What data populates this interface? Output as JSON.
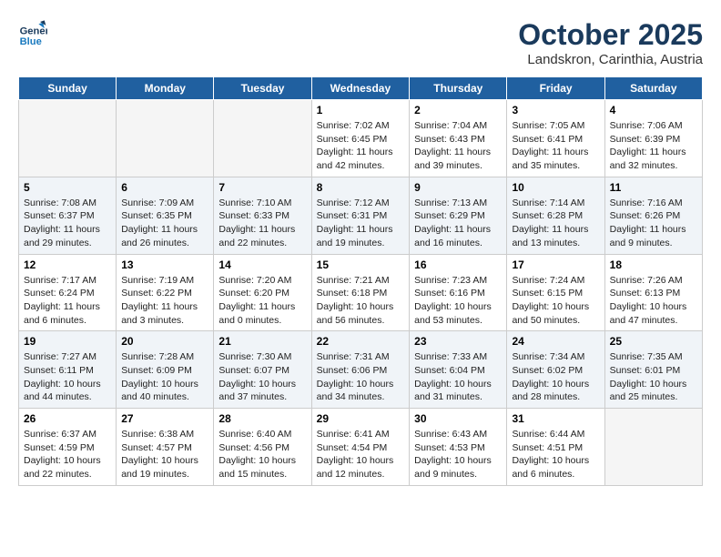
{
  "header": {
    "logo_line1": "General",
    "logo_line2": "Blue",
    "month": "October 2025",
    "location": "Landskron, Carinthia, Austria"
  },
  "weekdays": [
    "Sunday",
    "Monday",
    "Tuesday",
    "Wednesday",
    "Thursday",
    "Friday",
    "Saturday"
  ],
  "weeks": [
    [
      {
        "day": "",
        "info": ""
      },
      {
        "day": "",
        "info": ""
      },
      {
        "day": "",
        "info": ""
      },
      {
        "day": "1",
        "info": "Sunrise: 7:02 AM\nSunset: 6:45 PM\nDaylight: 11 hours\nand 42 minutes."
      },
      {
        "day": "2",
        "info": "Sunrise: 7:04 AM\nSunset: 6:43 PM\nDaylight: 11 hours\nand 39 minutes."
      },
      {
        "day": "3",
        "info": "Sunrise: 7:05 AM\nSunset: 6:41 PM\nDaylight: 11 hours\nand 35 minutes."
      },
      {
        "day": "4",
        "info": "Sunrise: 7:06 AM\nSunset: 6:39 PM\nDaylight: 11 hours\nand 32 minutes."
      }
    ],
    [
      {
        "day": "5",
        "info": "Sunrise: 7:08 AM\nSunset: 6:37 PM\nDaylight: 11 hours\nand 29 minutes."
      },
      {
        "day": "6",
        "info": "Sunrise: 7:09 AM\nSunset: 6:35 PM\nDaylight: 11 hours\nand 26 minutes."
      },
      {
        "day": "7",
        "info": "Sunrise: 7:10 AM\nSunset: 6:33 PM\nDaylight: 11 hours\nand 22 minutes."
      },
      {
        "day": "8",
        "info": "Sunrise: 7:12 AM\nSunset: 6:31 PM\nDaylight: 11 hours\nand 19 minutes."
      },
      {
        "day": "9",
        "info": "Sunrise: 7:13 AM\nSunset: 6:29 PM\nDaylight: 11 hours\nand 16 minutes."
      },
      {
        "day": "10",
        "info": "Sunrise: 7:14 AM\nSunset: 6:28 PM\nDaylight: 11 hours\nand 13 minutes."
      },
      {
        "day": "11",
        "info": "Sunrise: 7:16 AM\nSunset: 6:26 PM\nDaylight: 11 hours\nand 9 minutes."
      }
    ],
    [
      {
        "day": "12",
        "info": "Sunrise: 7:17 AM\nSunset: 6:24 PM\nDaylight: 11 hours\nand 6 minutes."
      },
      {
        "day": "13",
        "info": "Sunrise: 7:19 AM\nSunset: 6:22 PM\nDaylight: 11 hours\nand 3 minutes."
      },
      {
        "day": "14",
        "info": "Sunrise: 7:20 AM\nSunset: 6:20 PM\nDaylight: 11 hours\nand 0 minutes."
      },
      {
        "day": "15",
        "info": "Sunrise: 7:21 AM\nSunset: 6:18 PM\nDaylight: 10 hours\nand 56 minutes."
      },
      {
        "day": "16",
        "info": "Sunrise: 7:23 AM\nSunset: 6:16 PM\nDaylight: 10 hours\nand 53 minutes."
      },
      {
        "day": "17",
        "info": "Sunrise: 7:24 AM\nSunset: 6:15 PM\nDaylight: 10 hours\nand 50 minutes."
      },
      {
        "day": "18",
        "info": "Sunrise: 7:26 AM\nSunset: 6:13 PM\nDaylight: 10 hours\nand 47 minutes."
      }
    ],
    [
      {
        "day": "19",
        "info": "Sunrise: 7:27 AM\nSunset: 6:11 PM\nDaylight: 10 hours\nand 44 minutes."
      },
      {
        "day": "20",
        "info": "Sunrise: 7:28 AM\nSunset: 6:09 PM\nDaylight: 10 hours\nand 40 minutes."
      },
      {
        "day": "21",
        "info": "Sunrise: 7:30 AM\nSunset: 6:07 PM\nDaylight: 10 hours\nand 37 minutes."
      },
      {
        "day": "22",
        "info": "Sunrise: 7:31 AM\nSunset: 6:06 PM\nDaylight: 10 hours\nand 34 minutes."
      },
      {
        "day": "23",
        "info": "Sunrise: 7:33 AM\nSunset: 6:04 PM\nDaylight: 10 hours\nand 31 minutes."
      },
      {
        "day": "24",
        "info": "Sunrise: 7:34 AM\nSunset: 6:02 PM\nDaylight: 10 hours\nand 28 minutes."
      },
      {
        "day": "25",
        "info": "Sunrise: 7:35 AM\nSunset: 6:01 PM\nDaylight: 10 hours\nand 25 minutes."
      }
    ],
    [
      {
        "day": "26",
        "info": "Sunrise: 6:37 AM\nSunset: 4:59 PM\nDaylight: 10 hours\nand 22 minutes."
      },
      {
        "day": "27",
        "info": "Sunrise: 6:38 AM\nSunset: 4:57 PM\nDaylight: 10 hours\nand 19 minutes."
      },
      {
        "day": "28",
        "info": "Sunrise: 6:40 AM\nSunset: 4:56 PM\nDaylight: 10 hours\nand 15 minutes."
      },
      {
        "day": "29",
        "info": "Sunrise: 6:41 AM\nSunset: 4:54 PM\nDaylight: 10 hours\nand 12 minutes."
      },
      {
        "day": "30",
        "info": "Sunrise: 6:43 AM\nSunset: 4:53 PM\nDaylight: 10 hours\nand 9 minutes."
      },
      {
        "day": "31",
        "info": "Sunrise: 6:44 AM\nSunset: 4:51 PM\nDaylight: 10 hours\nand 6 minutes."
      },
      {
        "day": "",
        "info": ""
      }
    ]
  ]
}
